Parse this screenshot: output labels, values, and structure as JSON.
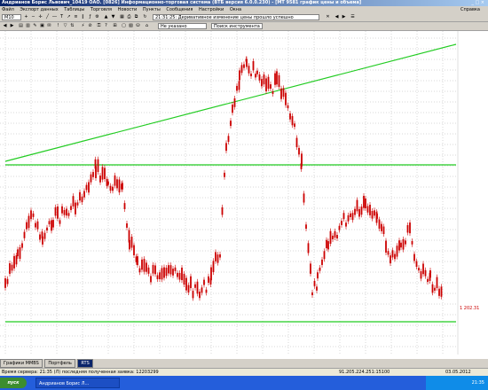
{
  "window": {
    "title": "Андрианов Борис Львович_10419 ОАО. [0826] Информационно-торговая система (ВТБ версия 6.0.0.230) - [MT 9581 график цены и объема]",
    "right_text": "Справка"
  },
  "menu": {
    "items": [
      "Файл",
      "Экспорт данных",
      "Таблицы",
      "Торговля",
      "Новости",
      "Пункты",
      "Сообщения",
      "Настройки",
      "Окна"
    ],
    "right": "Справка"
  },
  "toolbar": {
    "interval": "M10",
    "time_msg": "21:31:25: Деривативное изменение цены прошло успешно",
    "combo2": "Не указано",
    "search": "Поиск инструмента",
    "clock": "21:31"
  },
  "chart_data": {
    "type": "candlestick",
    "last_price_label": "1 202.31",
    "series": [
      {
        "name": "candles",
        "values": []
      }
    ]
  },
  "tabs": [
    {
      "label": "Графики MMBS",
      "active": false
    },
    {
      "label": "Портфель",
      "active": false
    },
    {
      "label": "RTS",
      "active": true
    }
  ],
  "info": {
    "server": "Время сервера: 21:35 (Л) последняя полученная заявка: 12203299",
    "ip": "91.205.224.251:15100",
    "date": "03.05.2012"
  },
  "taskbar": {
    "start": "пуск",
    "task": "Андрианов Борис Л...",
    "time": "21:35"
  },
  "colors": {
    "candle": "#cc0000",
    "trend": "#22cc22",
    "grid": "#b0b0b0"
  }
}
